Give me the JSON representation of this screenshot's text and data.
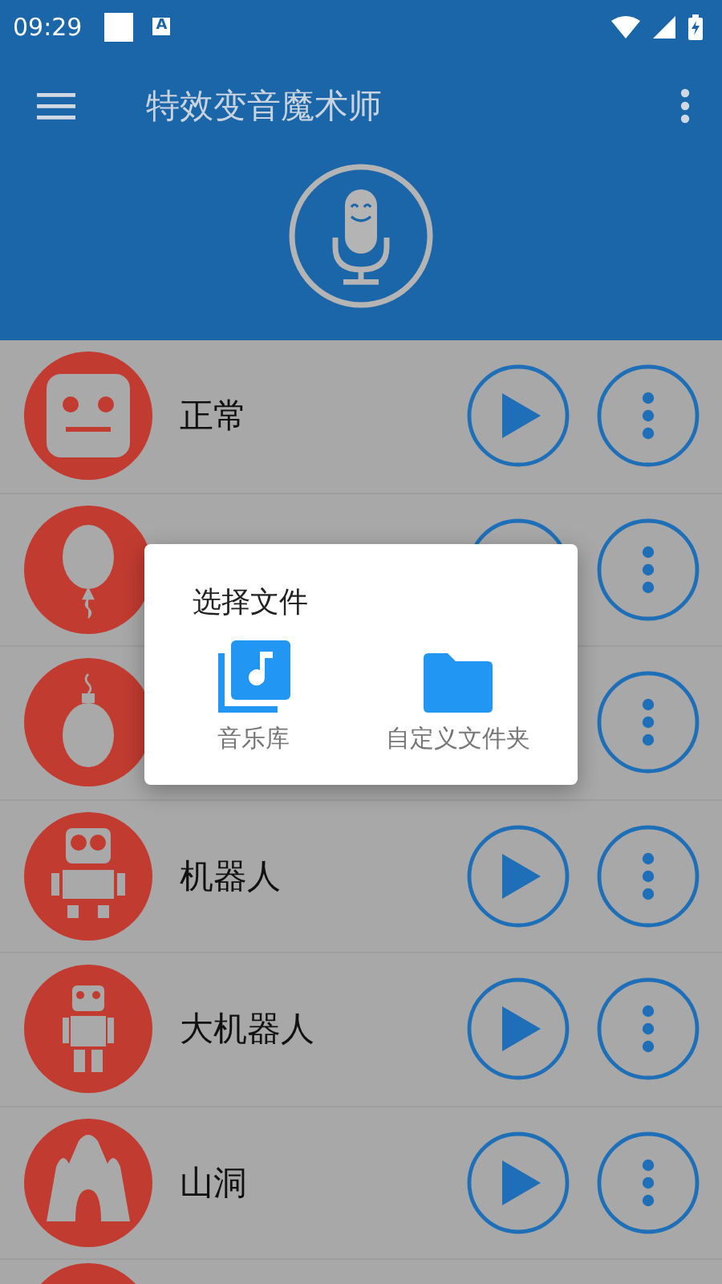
{
  "status_bar": {
    "time": "09:29",
    "notification_glyph": "A"
  },
  "app_bar": {
    "title": "特效变音魔术师"
  },
  "effects": [
    {
      "kind": "face",
      "name": "正常",
      "buttons": [
        {
          "kind": "play"
        },
        {
          "kind": "more"
        }
      ]
    },
    {
      "kind": "balloon",
      "buttons": [
        {
          "kind": "play"
        },
        {
          "kind": "more"
        }
      ]
    },
    {
      "kind": "ornament",
      "buttons": [
        {
          "kind": "more"
        }
      ]
    },
    {
      "kind": "robot",
      "name": "机器人",
      "buttons": [
        {
          "kind": "play"
        },
        {
          "kind": "more"
        }
      ]
    },
    {
      "kind": "big-robot",
      "name": "大机器人",
      "buttons": [
        {
          "kind": "play"
        },
        {
          "kind": "more"
        }
      ]
    },
    {
      "kind": "cave",
      "name": "山洞",
      "buttons": [
        {
          "kind": "play"
        },
        {
          "kind": "more"
        }
      ]
    },
    {
      "kind": "partial"
    }
  ],
  "dialog": {
    "title": "选择文件",
    "options": [
      {
        "kind": "music",
        "label": "音乐库"
      },
      {
        "kind": "folder",
        "label": "自定义文件夹"
      }
    ]
  }
}
